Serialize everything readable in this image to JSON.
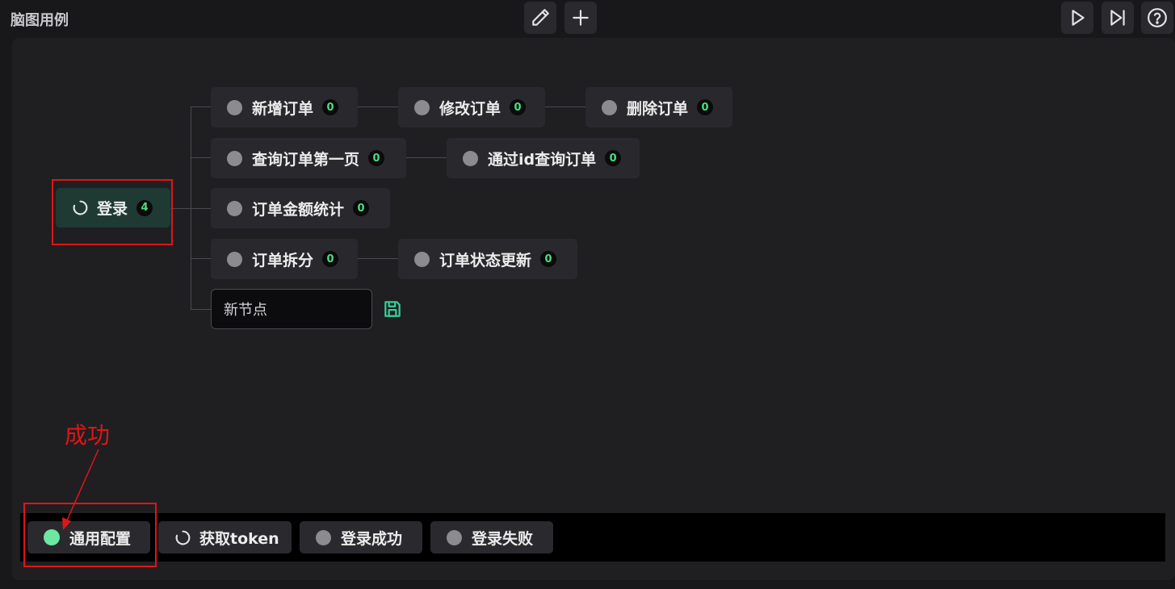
{
  "header": {
    "title": "脑图用例"
  },
  "toolbar": {
    "edit_icon": "pencil-icon",
    "add_icon": "plus-icon",
    "run_icon": "play-icon",
    "step_icon": "skip-forward-icon",
    "help_icon": "question-circle-icon"
  },
  "mindmap": {
    "root": {
      "label": "登录",
      "count": "4"
    },
    "nodes": [
      {
        "label": "新增订单",
        "count": "0"
      },
      {
        "label": "修改订单",
        "count": "0"
      },
      {
        "label": "删除订单",
        "count": "0"
      },
      {
        "label": "查询订单第一页",
        "count": "0"
      },
      {
        "label": "通过id查询订单",
        "count": "0"
      },
      {
        "label": "订单金额统计",
        "count": "0"
      },
      {
        "label": "订单拆分",
        "count": "0"
      },
      {
        "label": "订单状态更新",
        "count": "0"
      }
    ],
    "new_node": {
      "value": "新节点"
    }
  },
  "bottom": {
    "items": [
      {
        "label": "通用配置",
        "status": "success"
      },
      {
        "label": "获取token",
        "status": "loading"
      },
      {
        "label": "登录成功",
        "status": "idle"
      },
      {
        "label": "登录失败",
        "status": "idle"
      }
    ]
  },
  "annotation": {
    "text": "成功"
  },
  "colors": {
    "success": "#6ee7a0",
    "badge_text": "#4ade80",
    "root_bg": "#1e3a33",
    "highlight": "#e01515"
  }
}
